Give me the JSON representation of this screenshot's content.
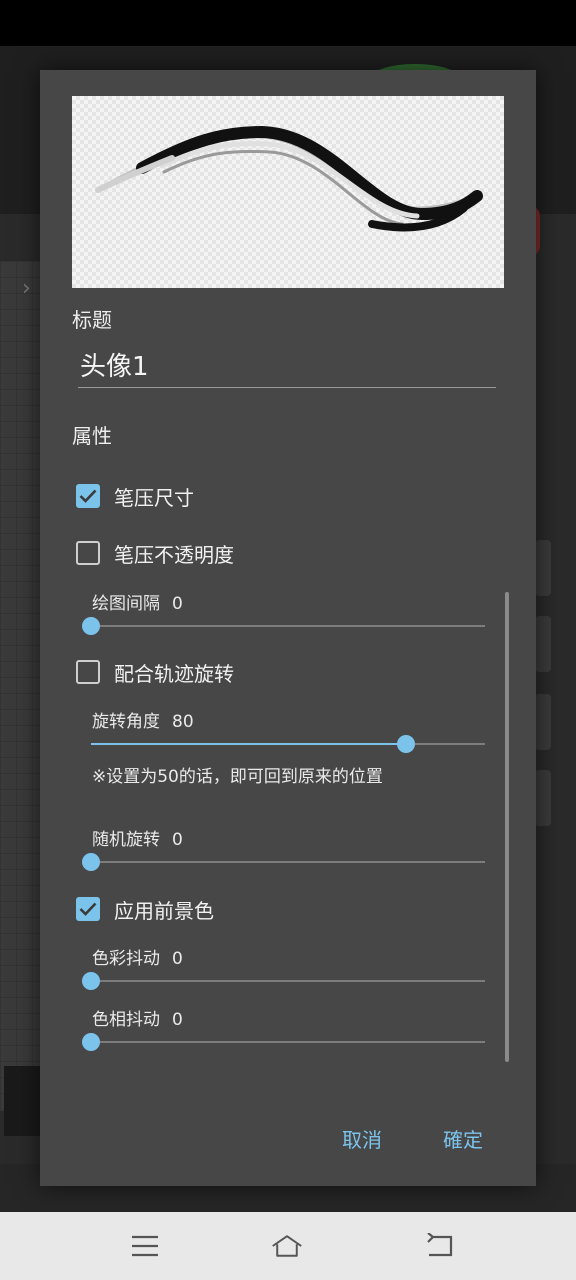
{
  "dialog": {
    "title_section_label": "标题",
    "title_value": "头像1",
    "properties_label": "属性",
    "checkboxes": {
      "pressure_size": {
        "label": "笔压尺寸",
        "checked": true
      },
      "pressure_opacity": {
        "label": "笔压不透明度",
        "checked": false
      },
      "follow_rotation": {
        "label": "配合轨迹旋转",
        "checked": false
      },
      "apply_fg_color": {
        "label": "应用前景色",
        "checked": true
      }
    },
    "sliders": {
      "spacing": {
        "label": "绘图间隔",
        "value": "0",
        "fraction": 0.0
      },
      "rotation_angle": {
        "label": "旋转角度",
        "value": "80",
        "fraction": 0.8
      },
      "random_rotation": {
        "label": "随机旋转",
        "value": "0",
        "fraction": 0.0
      },
      "color_jitter": {
        "label": "色彩抖动",
        "value": "0",
        "fraction": 0.0
      },
      "hue_jitter": {
        "label": "色相抖动",
        "value": "0",
        "fraction": 0.0
      }
    },
    "rotation_note": "※设置为50的话，即可回到原来的位置",
    "buttons": {
      "cancel": "取消",
      "ok": "確定"
    }
  },
  "colors": {
    "accent": "#7cc3ec",
    "dialog_bg": "#474747"
  },
  "navbar": {
    "icons": [
      "menu-icon",
      "home-icon",
      "back-icon"
    ]
  }
}
